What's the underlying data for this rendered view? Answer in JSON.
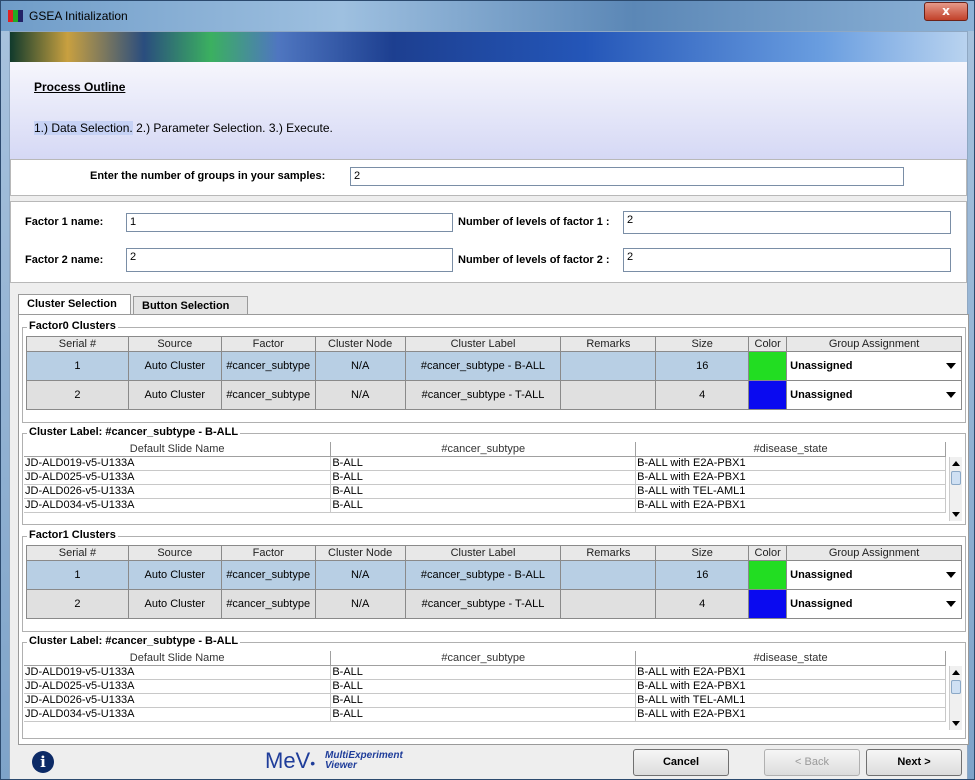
{
  "window": {
    "title": "GSEA Initialization",
    "close_label": "x"
  },
  "outline": {
    "title": "Process Outline",
    "step1": "1.) Data Selection.",
    "step2": "2.) Parameter Selection.",
    "step3": "3.) Execute."
  },
  "groups": {
    "label": "Enter the number of groups in your samples:",
    "value": "2"
  },
  "factors": {
    "f1_name_label": "Factor 1 name:",
    "f1_name_value": "1",
    "f1_levels_label": "Number of levels of factor 1 :",
    "f1_levels_value": "2",
    "f2_name_label": "Factor 2 name:",
    "f2_name_value": "2",
    "f2_levels_label": "Number of levels of factor 2 :",
    "f2_levels_value": "2"
  },
  "tabs": {
    "cluster": "Cluster Selection",
    "button": "Button Selection"
  },
  "cluster_columns": [
    "Serial #",
    "Source",
    "Factor",
    "Cluster Node",
    "Cluster Label",
    "Remarks",
    "Size",
    "Color",
    "Group Assignment"
  ],
  "factor0": {
    "title": "Factor0 Clusters",
    "rows": [
      {
        "serial": "1",
        "source": "Auto Cluster",
        "factor": "#cancer_subtype",
        "node": "N/A",
        "label": "#cancer_subtype - B-ALL",
        "remarks": "",
        "size": "16",
        "color": "#22dd22",
        "group": "Unassigned"
      },
      {
        "serial": "2",
        "source": "Auto Cluster",
        "factor": "#cancer_subtype",
        "node": "N/A",
        "label": "#cancer_subtype - T-ALL",
        "remarks": "",
        "size": "4",
        "color": "#0a0af0",
        "group": "Unassigned"
      }
    ]
  },
  "factor1": {
    "title": "Factor1 Clusters",
    "rows": [
      {
        "serial": "1",
        "source": "Auto Cluster",
        "factor": "#cancer_subtype",
        "node": "N/A",
        "label": "#cancer_subtype - B-ALL",
        "remarks": "",
        "size": "16",
        "color": "#22dd22",
        "group": "Unassigned"
      },
      {
        "serial": "2",
        "source": "Auto Cluster",
        "factor": "#cancer_subtype",
        "node": "N/A",
        "label": "#cancer_subtype - T-ALL",
        "remarks": "",
        "size": "4",
        "color": "#0a0af0",
        "group": "Unassigned"
      }
    ]
  },
  "sample_columns": [
    "Default Slide Name",
    "#cancer_subtype",
    "#disease_state"
  ],
  "label0": {
    "title": "Cluster Label: #cancer_subtype - B-ALL",
    "rows": [
      [
        "JD-ALD019-v5-U133A",
        "B-ALL",
        "B-ALL with E2A-PBX1"
      ],
      [
        "JD-ALD025-v5-U133A",
        "B-ALL",
        "B-ALL with E2A-PBX1"
      ],
      [
        "JD-ALD026-v5-U133A",
        "B-ALL",
        "B-ALL with TEL-AML1"
      ],
      [
        "JD-ALD034-v5-U133A",
        "B-ALL",
        "B-ALL with E2A-PBX1"
      ]
    ]
  },
  "label1": {
    "title": "Cluster Label: #cancer_subtype - B-ALL",
    "rows": [
      [
        "JD-ALD019-v5-U133A",
        "B-ALL",
        "B-ALL with E2A-PBX1"
      ],
      [
        "JD-ALD025-v5-U133A",
        "B-ALL",
        "B-ALL with E2A-PBX1"
      ],
      [
        "JD-ALD026-v5-U133A",
        "B-ALL",
        "B-ALL with TEL-AML1"
      ],
      [
        "JD-ALD034-v5-U133A",
        "B-ALL",
        "B-ALL with E2A-PBX1"
      ]
    ]
  },
  "footer": {
    "info_icon": "info-icon",
    "logo_main": "MeV",
    "logo_dot": "•",
    "logo_sub1": "MultiExperiment",
    "logo_sub2": "Viewer",
    "cancel": "Cancel",
    "back": "< Back",
    "next": "Next >"
  }
}
